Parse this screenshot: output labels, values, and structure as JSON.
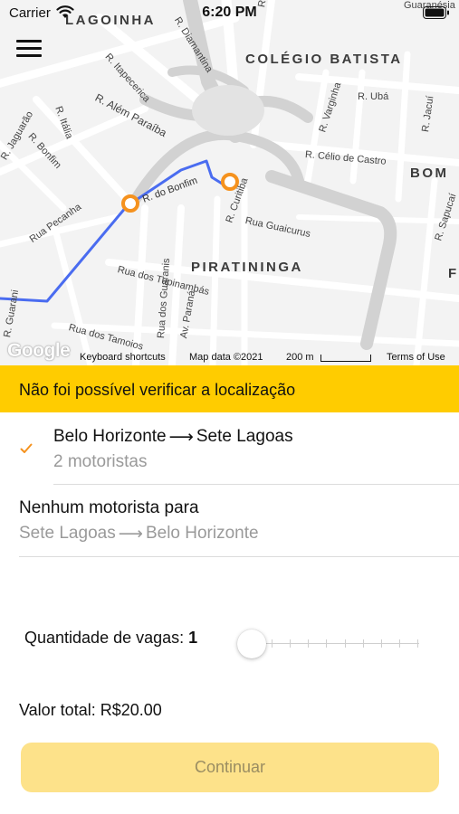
{
  "status_bar": {
    "carrier": "Carrier",
    "time": "6:20 PM"
  },
  "map": {
    "districts": [
      "LAGOINHA",
      "COLÉGIO BATISTA",
      "BOM",
      "PIRATININGA",
      "F"
    ],
    "streets": [
      "R. Itapecerica",
      "R. Diamantina",
      "R. Além Paraíba",
      "R. Itália",
      "R. Bonfim",
      "R. Jaguarão",
      "R. Varginha",
      "R. Ubá",
      "R. Jacuí",
      "R. Célio de Castro",
      "R. do Bonfim",
      "R. Curitiba",
      "Rua Guaicurus",
      "Rua Pecanha",
      "Rua dos Tupinambás",
      "Rua dos Guaranis",
      "Av. Paraná",
      "Rua dos Tamoios",
      "R. Sapucaí",
      "R. Guarani",
      "R. Pará",
      "Guaranésia"
    ],
    "google_logo": "Google",
    "keyboard_shortcuts": "Keyboard shortcuts",
    "map_data": "Map data ©2021",
    "scale": "200 m",
    "terms": "Terms of Use",
    "colors": {
      "route": "#4a6cf0",
      "marker": "#f5921e"
    }
  },
  "warning": {
    "text": "Não foi possível verificar a localização",
    "color": "#ffcc00"
  },
  "routes": [
    {
      "from": "Belo Horizonte",
      "to": "Sete Lagoas",
      "detail": "2 motoristas",
      "selected": true,
      "icon": "checkmark-icon"
    },
    {
      "title": "Nenhum motorista para",
      "from": "Sete Lagoas",
      "to": "Belo Horizonte"
    }
  ],
  "arrow_glyph": "⟶",
  "seats": {
    "label": "Quantidade de vagas:",
    "value": "1",
    "slider_value": 1,
    "slider_min": 1,
    "slider_max": 10
  },
  "total": {
    "text": "Valor total: R$20.00"
  },
  "continue_button": {
    "label": "Continuar",
    "color": "#fde28a"
  }
}
